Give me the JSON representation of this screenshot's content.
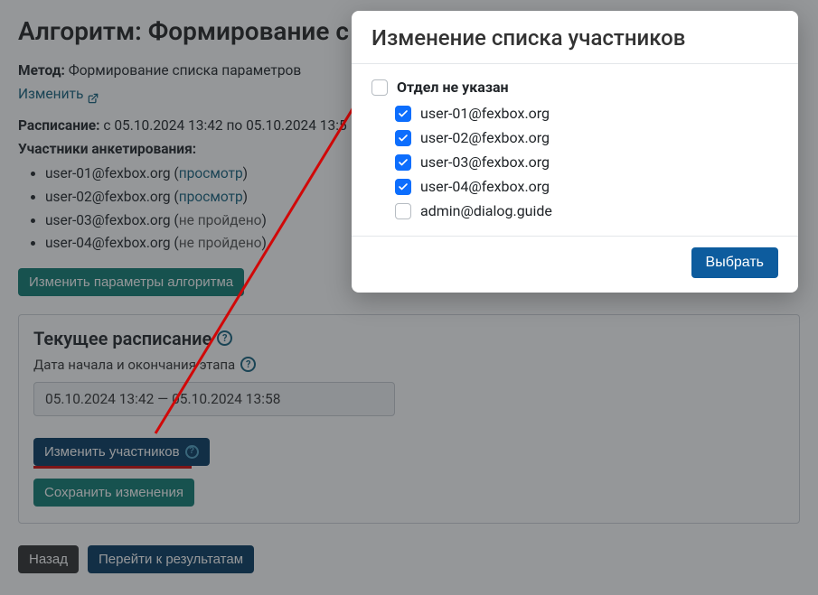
{
  "page": {
    "title": "Алгоритм: Формирование с",
    "method_label": "Метод:",
    "method_value": "Формирование списка параметров",
    "edit_link_label": "Изменить",
    "schedule_label": "Расписание:",
    "schedule_value": "с 05.10.2024 13:42 по 05.10.2024 13:5",
    "participants_label": "Участники анкетирования:",
    "participants": [
      {
        "email": "user-01@fexbox.org",
        "status": "просмотр",
        "status_clickable": true
      },
      {
        "email": "user-02@fexbox.org",
        "status": "просмотр",
        "status_clickable": true
      },
      {
        "email": "user-03@fexbox.org",
        "status": "не пройдено",
        "status_clickable": false
      },
      {
        "email": "user-04@fexbox.org",
        "status": "не пройдено",
        "status_clickable": false
      }
    ],
    "btn_change_params": "Изменить параметры алгоритма"
  },
  "card": {
    "title": "Текущее расписание",
    "subtitle": "Дата начала и окончания этапа",
    "daterange": "05.10.2024 13:42 — 05.10.2024 13:58",
    "btn_change_participants": "Изменить участников",
    "btn_save": "Сохранить изменения"
  },
  "footer": {
    "btn_back": "Назад",
    "btn_results": "Перейти к результатам"
  },
  "modal": {
    "title": "Изменение списка участников",
    "group_label": "Отдел не указан",
    "users": [
      {
        "email": "user-01@fexbox.org",
        "checked": true
      },
      {
        "email": "user-02@fexbox.org",
        "checked": true
      },
      {
        "email": "user-03@fexbox.org",
        "checked": true
      },
      {
        "email": "user-04@fexbox.org",
        "checked": true
      },
      {
        "email": "admin@dialog.guide",
        "checked": false
      }
    ],
    "btn_select": "Выбрать"
  }
}
